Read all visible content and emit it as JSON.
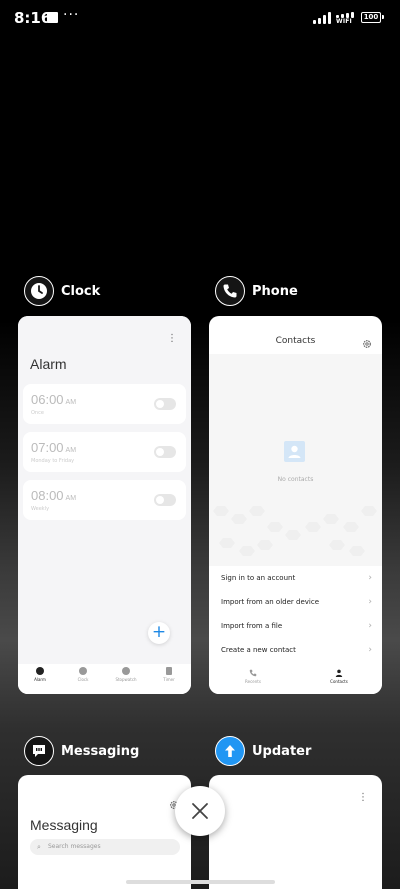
{
  "status_bar": {
    "time": "8:16",
    "more": "···",
    "wifi_label": "WIFI",
    "battery": "100"
  },
  "apps": {
    "clock": {
      "name": "Clock",
      "title": "Alarm",
      "alarms": [
        {
          "time": "06:00",
          "ampm": "AM",
          "sub": "Once"
        },
        {
          "time": "07:00",
          "ampm": "AM",
          "sub": "Monday to Friday"
        },
        {
          "time": "08:00",
          "ampm": "AM",
          "sub": "Weekly"
        }
      ],
      "add_label": "+",
      "nav": [
        "Alarm",
        "Clock",
        "Stopwatch",
        "Timer"
      ]
    },
    "phone": {
      "name": "Phone",
      "title": "Contacts",
      "empty_text": "No contacts",
      "actions": [
        "Sign in to an account",
        "Import from an older device",
        "Import from a file",
        "Create a new contact"
      ],
      "nav": [
        "Recents",
        "Contacts"
      ]
    },
    "messaging": {
      "name": "Messaging",
      "title": "Messaging",
      "search_placeholder": "Search messages"
    },
    "updater": {
      "name": "Updater"
    }
  },
  "colors": {
    "accent_blue": "#1e88e5",
    "updater_blue": "#2196f3"
  }
}
